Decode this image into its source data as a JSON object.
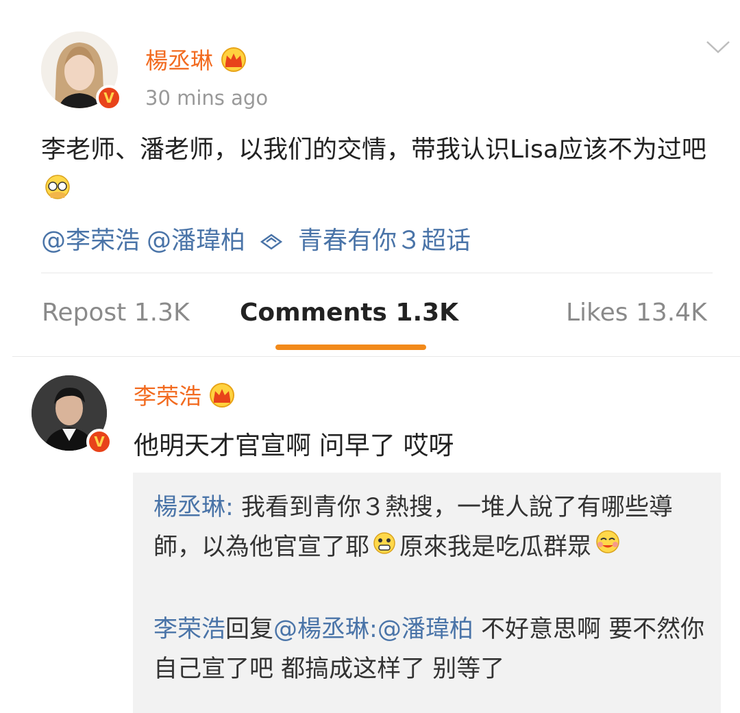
{
  "post": {
    "author": "楊丞琳",
    "time": "30 mins ago",
    "text": "李老师、潘老师，以我们的交情，带我认识Lisa应该不为过吧",
    "mentions": [
      "@李荣浩",
      "@潘瑋柏"
    ],
    "topic": "青春有你３超话"
  },
  "tabs": {
    "repost": "Repost 1.3K",
    "comments": "Comments 1.3K",
    "likes": "Likes 13.4K"
  },
  "comment": {
    "author": "李荣浩",
    "text": "他明天才官宣啊 问早了 哎呀",
    "replies": [
      {
        "who": "楊丞琳",
        "sep": ": ",
        "text_a": "我看到青你３熱搜，一堆人說了有哪些導師，以為他官宣了耶",
        "text_b": "原來我是吃瓜群眾"
      },
      {
        "who": "李荣浩",
        "mid": "回复",
        "target": "@楊丞琳:@潘瑋柏",
        "text": " 不好意思啊 要不然你自己宣了吧 都搞成这样了 别等了"
      }
    ]
  },
  "colors": {
    "name": "#f26b20",
    "link": "#4a74a8",
    "tab_underline": "#f28a1a",
    "verified": "#e8431a"
  },
  "icons": [
    "crown-icon",
    "verified-icon",
    "chevron-down-icon",
    "topic-icon",
    "hand-over-face-emoji",
    "shocked-emoji",
    "drooling-emoji"
  ]
}
